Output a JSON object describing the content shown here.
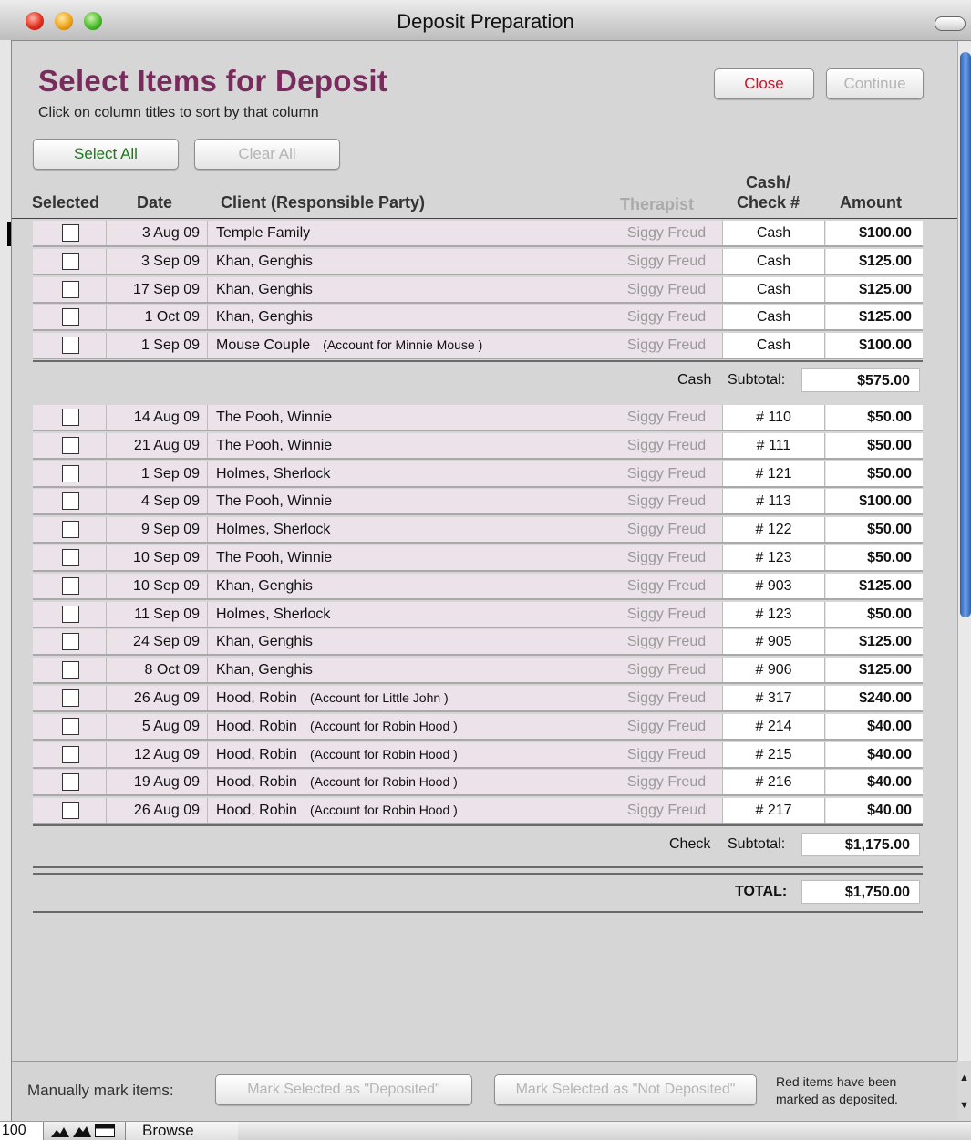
{
  "window": {
    "title": "Deposit Preparation"
  },
  "header": {
    "title": "Select Items for Deposit",
    "subtitle": "Click on column titles to sort by that column",
    "close_label": "Close",
    "continue_label": "Continue",
    "select_all_label": "Select All",
    "clear_all_label": "Clear All"
  },
  "columns": {
    "selected": "Selected",
    "date": "Date",
    "client": "Client (Responsible Party)",
    "therapist": "Therapist",
    "cash_check_line1": "Cash/",
    "cash_check_line2": "Check #",
    "amount": "Amount"
  },
  "cash_rows": [
    {
      "date": "3 Aug 09",
      "client": "Temple Family",
      "account": "",
      "therapist": "Siggy Freud",
      "check": "Cash",
      "amount": "$100.00",
      "selected": false
    },
    {
      "date": "3 Sep 09",
      "client": "Khan, Genghis",
      "account": "",
      "therapist": "Siggy Freud",
      "check": "Cash",
      "amount": "$125.00",
      "selected": false
    },
    {
      "date": "17 Sep 09",
      "client": "Khan, Genghis",
      "account": "",
      "therapist": "Siggy Freud",
      "check": "Cash",
      "amount": "$125.00",
      "selected": false
    },
    {
      "date": "1 Oct 09",
      "client": "Khan, Genghis",
      "account": "",
      "therapist": "Siggy Freud",
      "check": "Cash",
      "amount": "$125.00",
      "selected": false
    },
    {
      "date": "1 Sep 09",
      "client": "Mouse Couple",
      "account": "(Account for Minnie Mouse )",
      "therapist": "Siggy Freud",
      "check": "Cash",
      "amount": "$100.00",
      "selected": false
    }
  ],
  "cash_subtotal": {
    "type_label": "Cash",
    "label": "Subtotal:",
    "value": "$575.00"
  },
  "check_rows": [
    {
      "date": "14 Aug 09",
      "client": "The Pooh, Winnie",
      "account": "",
      "therapist": "Siggy Freud",
      "check": "# 110",
      "amount": "$50.00",
      "selected": false
    },
    {
      "date": "21 Aug 09",
      "client": "The Pooh, Winnie",
      "account": "",
      "therapist": "Siggy Freud",
      "check": "# 111",
      "amount": "$50.00",
      "selected": false
    },
    {
      "date": "1 Sep 09",
      "client": "Holmes, Sherlock",
      "account": "",
      "therapist": "Siggy Freud",
      "check": "# 121",
      "amount": "$50.00",
      "selected": false
    },
    {
      "date": "4 Sep 09",
      "client": "The Pooh, Winnie",
      "account": "",
      "therapist": "Siggy Freud",
      "check": "# 113",
      "amount": "$100.00",
      "selected": false
    },
    {
      "date": "9 Sep 09",
      "client": "Holmes, Sherlock",
      "account": "",
      "therapist": "Siggy Freud",
      "check": "# 122",
      "amount": "$50.00",
      "selected": false
    },
    {
      "date": "10 Sep 09",
      "client": "The Pooh, Winnie",
      "account": "",
      "therapist": "Siggy Freud",
      "check": "# 123",
      "amount": "$50.00",
      "selected": false
    },
    {
      "date": "10 Sep 09",
      "client": "Khan, Genghis",
      "account": "",
      "therapist": "Siggy Freud",
      "check": "# 903",
      "amount": "$125.00",
      "selected": false
    },
    {
      "date": "11 Sep 09",
      "client": "Holmes, Sherlock",
      "account": "",
      "therapist": "Siggy Freud",
      "check": "# 123",
      "amount": "$50.00",
      "selected": false
    },
    {
      "date": "24 Sep 09",
      "client": "Khan, Genghis",
      "account": "",
      "therapist": "Siggy Freud",
      "check": "# 905",
      "amount": "$125.00",
      "selected": false
    },
    {
      "date": "8 Oct 09",
      "client": "Khan, Genghis",
      "account": "",
      "therapist": "Siggy Freud",
      "check": "# 906",
      "amount": "$125.00",
      "selected": false
    },
    {
      "date": "26 Aug 09",
      "client": "Hood, Robin",
      "account": "(Account for Little John )",
      "therapist": "Siggy Freud",
      "check": "# 317",
      "amount": "$240.00",
      "selected": false
    },
    {
      "date": "5 Aug 09",
      "client": "Hood, Robin",
      "account": "(Account for Robin Hood )",
      "therapist": "Siggy Freud",
      "check": "# 214",
      "amount": "$40.00",
      "selected": false
    },
    {
      "date": "12 Aug 09",
      "client": "Hood, Robin",
      "account": "(Account for Robin Hood )",
      "therapist": "Siggy Freud",
      "check": "# 215",
      "amount": "$40.00",
      "selected": false
    },
    {
      "date": "19 Aug 09",
      "client": "Hood, Robin",
      "account": "(Account for Robin Hood )",
      "therapist": "Siggy Freud",
      "check": "# 216",
      "amount": "$40.00",
      "selected": false
    },
    {
      "date": "26 Aug 09",
      "client": "Hood, Robin",
      "account": "(Account for Robin Hood )",
      "therapist": "Siggy Freud",
      "check": "# 217",
      "amount": "$40.00",
      "selected": false
    }
  ],
  "check_subtotal": {
    "type_label": "Check",
    "label": "Subtotal:",
    "value": "$1,175.00"
  },
  "total": {
    "label": "TOTAL:",
    "value": "$1,750.00"
  },
  "footer": {
    "manual_label": "Manually mark items:",
    "mark_deposited_label": "Mark Selected as \"Deposited\"",
    "mark_not_deposited_label": "Mark Selected as \"Not Deposited\"",
    "note_line1": "Red items have been",
    "note_line2": "marked as deposited."
  },
  "statusbar": {
    "zoom": "100",
    "mode": "Browse"
  },
  "colors": {
    "heading": "#7a2b5e",
    "close": "#c0182b",
    "select_all": "#1c7a1c",
    "row_bg": "#ece2ea",
    "disabled": "#b5b5b5"
  }
}
